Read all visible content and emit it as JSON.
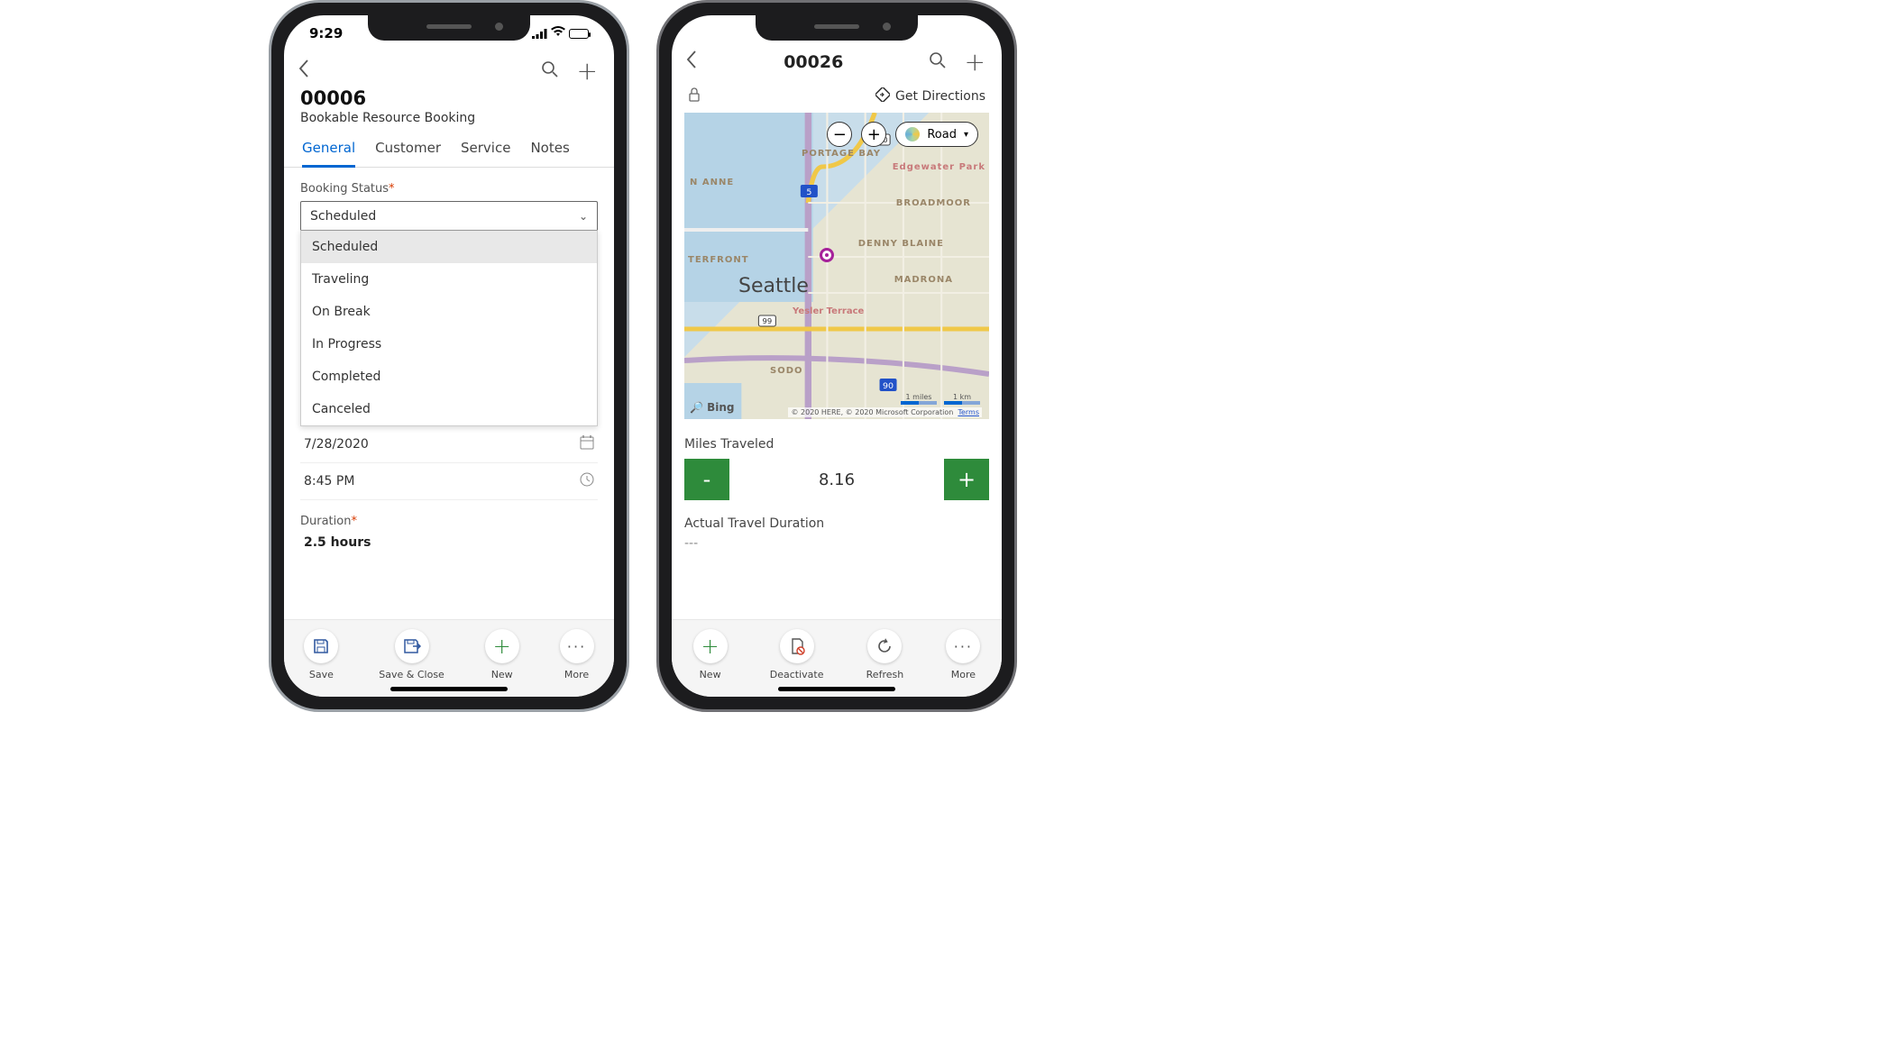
{
  "left": {
    "status_time": "9:29",
    "header": {
      "title": "00006",
      "subtitle": "Bookable Resource Booking"
    },
    "tabs": [
      "General",
      "Customer",
      "Service",
      "Notes"
    ],
    "active_tab": 0,
    "booking_status": {
      "label": "Booking Status",
      "required_marker": "*",
      "value": "Scheduled",
      "options": [
        "Scheduled",
        "Traveling",
        "On Break",
        "In Progress",
        "Completed",
        "Canceled"
      ]
    },
    "date_row": "7/28/2020",
    "time_row": "8:45 PM",
    "duration": {
      "label": "Duration",
      "required_marker": "*",
      "value": "2.5 hours"
    },
    "bottom": {
      "save": "Save",
      "save_close": "Save & Close",
      "new": "New",
      "more": "More"
    }
  },
  "right": {
    "header_title": "00026",
    "get_directions": "Get Directions",
    "map": {
      "zoom_out": "−",
      "zoom_in": "+",
      "mode_label": "Road",
      "neighborhoods": [
        "PORTAGE BAY",
        "Edgewater Park",
        "BROADMOOR",
        "DENNY BLAINE",
        "MADRONA",
        "Yesler Terrace",
        "SODO",
        "N ANNE",
        "TERFRONT"
      ],
      "seattle_label": "Seattle",
      "bing": "Bing",
      "scale_miles": "1 miles",
      "scale_km": "1 km",
      "attribution": "© 2020 HERE, © 2020 Microsoft Corporation",
      "terms": "Terms"
    },
    "miles_label": "Miles Traveled",
    "miles_value": "8.16",
    "travel_label": "Actual Travel Duration",
    "travel_value": "---",
    "bottom": {
      "new": "New",
      "deactivate": "Deactivate",
      "refresh": "Refresh",
      "more": "More"
    }
  }
}
